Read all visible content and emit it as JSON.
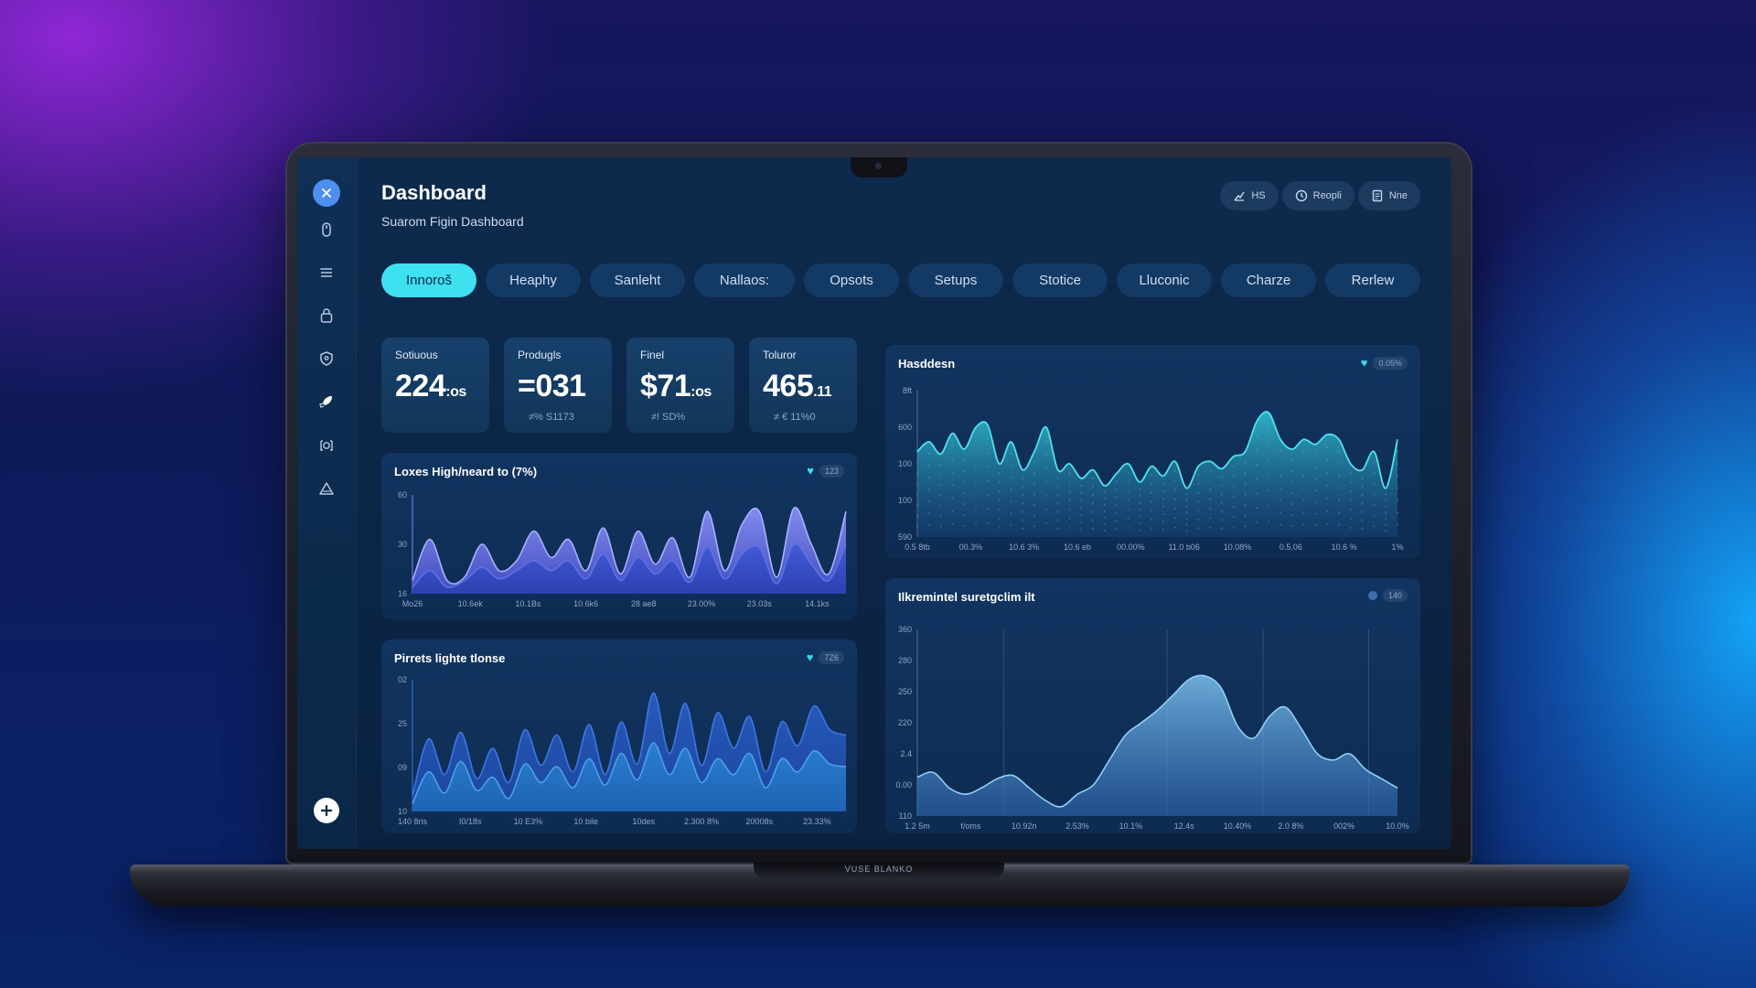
{
  "header": {
    "title": "Dashboard",
    "subtitle": "Suarom Figin Dashboard",
    "actions": [
      {
        "label": "HS",
        "icon": "chart-icon"
      },
      {
        "label": "Reopli",
        "icon": "clock-icon"
      },
      {
        "label": "Nne",
        "icon": "document-icon"
      }
    ]
  },
  "tabs": [
    {
      "label": "Innoroš",
      "active": true
    },
    {
      "label": "Heaphy",
      "active": false
    },
    {
      "label": "Sanleht",
      "active": false
    },
    {
      "label": "Nallaos:",
      "active": false
    },
    {
      "label": "Opsots",
      "active": false
    },
    {
      "label": "Setups",
      "active": false
    },
    {
      "label": "Stotice",
      "active": false
    },
    {
      "label": "Lluconic",
      "active": false
    },
    {
      "label": "Charze",
      "active": false
    },
    {
      "label": "Rerlew",
      "active": false
    }
  ],
  "sidebar": {
    "items": [
      {
        "icon": "close-icon"
      },
      {
        "icon": "mouse-icon"
      },
      {
        "icon": "list-icon"
      },
      {
        "icon": "lock-icon"
      },
      {
        "icon": "shield-icon"
      },
      {
        "icon": "rocket-icon"
      },
      {
        "icon": "camera-icon"
      },
      {
        "icon": "warning-icon"
      },
      {
        "icon": "plus-icon"
      }
    ]
  },
  "stats": [
    {
      "label": "Sotiuous",
      "value": "224",
      "suffix": ":os",
      "sub": ""
    },
    {
      "label": "Produgls",
      "value": "=031",
      "suffix": "",
      "sub": "≠% S1173"
    },
    {
      "label": "Finel",
      "value": "$71",
      "suffix": ":os",
      "sub": "≠! SD%"
    },
    {
      "label": "Toluror",
      "value": "465",
      "suffix": ".11",
      "sub": "≠ € 11%0"
    }
  ],
  "charts": {
    "top_left": {
      "title": "Loxes High/neard to (7%)",
      "badge": "123"
    },
    "bottom_left": {
      "title": "Pirrets lighte tlonse",
      "badge": "7Z6"
    },
    "top_right": {
      "title": "Hasddesn",
      "badge": "0.05%"
    },
    "bottom_right": {
      "title": "Ilkremintel suretgclim ilt",
      "badge": "140"
    }
  },
  "colors": {
    "accent": "#3fe0f0",
    "purple_area": "#6a78f0",
    "blue_area": "#2f6bd0",
    "teal_area": "#2fb5c6",
    "soft_blue_area": "#4a8fcf"
  },
  "laptop": {
    "brand": "VUSE BLANKO"
  },
  "chart_data": [
    {
      "type": "area",
      "title": "Loxes High/neard to (7%)",
      "x": [
        "Mo26",
        "",
        "10.6ek",
        "",
        "10.1Bs",
        "",
        "10.6k6",
        "",
        "28 ae8",
        "",
        "23.00%",
        "",
        "23.03s",
        "",
        "14.1ks",
        ""
      ],
      "series": [
        {
          "values": [
            8,
            33,
            8,
            10,
            30,
            14,
            20,
            38,
            22,
            33,
            14,
            40,
            12,
            38,
            18,
            34,
            10,
            50,
            14,
            42,
            50,
            10,
            52,
            30,
            12,
            50
          ]
        },
        {
          "values": [
            4,
            14,
            4,
            8,
            16,
            9,
            14,
            20,
            14,
            20,
            9,
            24,
            8,
            22,
            12,
            20,
            7,
            28,
            9,
            24,
            28,
            6,
            30,
            18,
            8,
            30
          ]
        }
      ],
      "yticks": [
        "60",
        "30",
        "16"
      ],
      "ylim": [
        0,
        60
      ]
    },
    {
      "type": "area",
      "title": "Pirrets lighte tlonse",
      "x": [
        "140 8ris",
        "",
        "I0/18s",
        "",
        "10 E3%",
        "",
        "10 bile",
        "",
        "10des",
        "",
        "2.300 8%",
        "",
        "20008s",
        "",
        "23.33%",
        ""
      ],
      "series": [
        {
          "values": [
            12,
            55,
            28,
            60,
            25,
            48,
            22,
            62,
            35,
            58,
            30,
            66,
            28,
            68,
            36,
            90,
            44,
            82,
            35,
            75,
            48,
            72,
            30,
            68,
            50,
            80,
            62,
            58
          ]
        },
        {
          "values": [
            6,
            30,
            14,
            38,
            16,
            26,
            10,
            36,
            22,
            34,
            18,
            40,
            20,
            44,
            24,
            52,
            28,
            48,
            22,
            40,
            28,
            44,
            18,
            40,
            30,
            46,
            36,
            34
          ]
        }
      ],
      "yticks": [
        "02",
        "25",
        "09",
        "10"
      ],
      "ylim": [
        0,
        100
      ]
    },
    {
      "type": "area",
      "title": "Hasddesn",
      "x": [
        "0.5 8tb",
        "00.3%",
        "10.6 3%",
        "10.6 eb",
        "00.00%",
        "11.0 b06",
        "10.08%",
        "0.5.06",
        "10.6 %",
        "1%"
      ],
      "series": [
        {
          "values": [
            70,
            78,
            68,
            85,
            72,
            90,
            92,
            60,
            78,
            55,
            70,
            90,
            55,
            60,
            48,
            55,
            42,
            52,
            60,
            45,
            58,
            50,
            62,
            40,
            58,
            62,
            56,
            66,
            70,
            95,
            102,
            80,
            72,
            80,
            76,
            84,
            80,
            60,
            55,
            70,
            40,
            80
          ]
        }
      ],
      "yticks": [
        "8ft",
        "600",
        "100",
        "100",
        "590"
      ],
      "ylim": [
        0,
        120
      ]
    },
    {
      "type": "area",
      "title": "Ilkremintel suretgclim ilt",
      "x": [
        "1.2 5m",
        "f/oms",
        "10.92n",
        "2.53%",
        "10.1%",
        "12.4s",
        "10.40%",
        "2.0 8%",
        "002%",
        "10.0%"
      ],
      "series": [
        {
          "values": [
            25,
            28,
            18,
            14,
            18,
            24,
            26,
            18,
            10,
            6,
            14,
            20,
            36,
            52,
            60,
            68,
            78,
            88,
            90,
            82,
            58,
            50,
            64,
            70,
            56,
            40,
            36,
            40,
            30,
            24,
            18
          ]
        }
      ],
      "yticks": [
        "360",
        "280",
        "250",
        "220",
        "2.4",
        "0.00",
        "110"
      ],
      "ylim": [
        0,
        120
      ]
    }
  ]
}
